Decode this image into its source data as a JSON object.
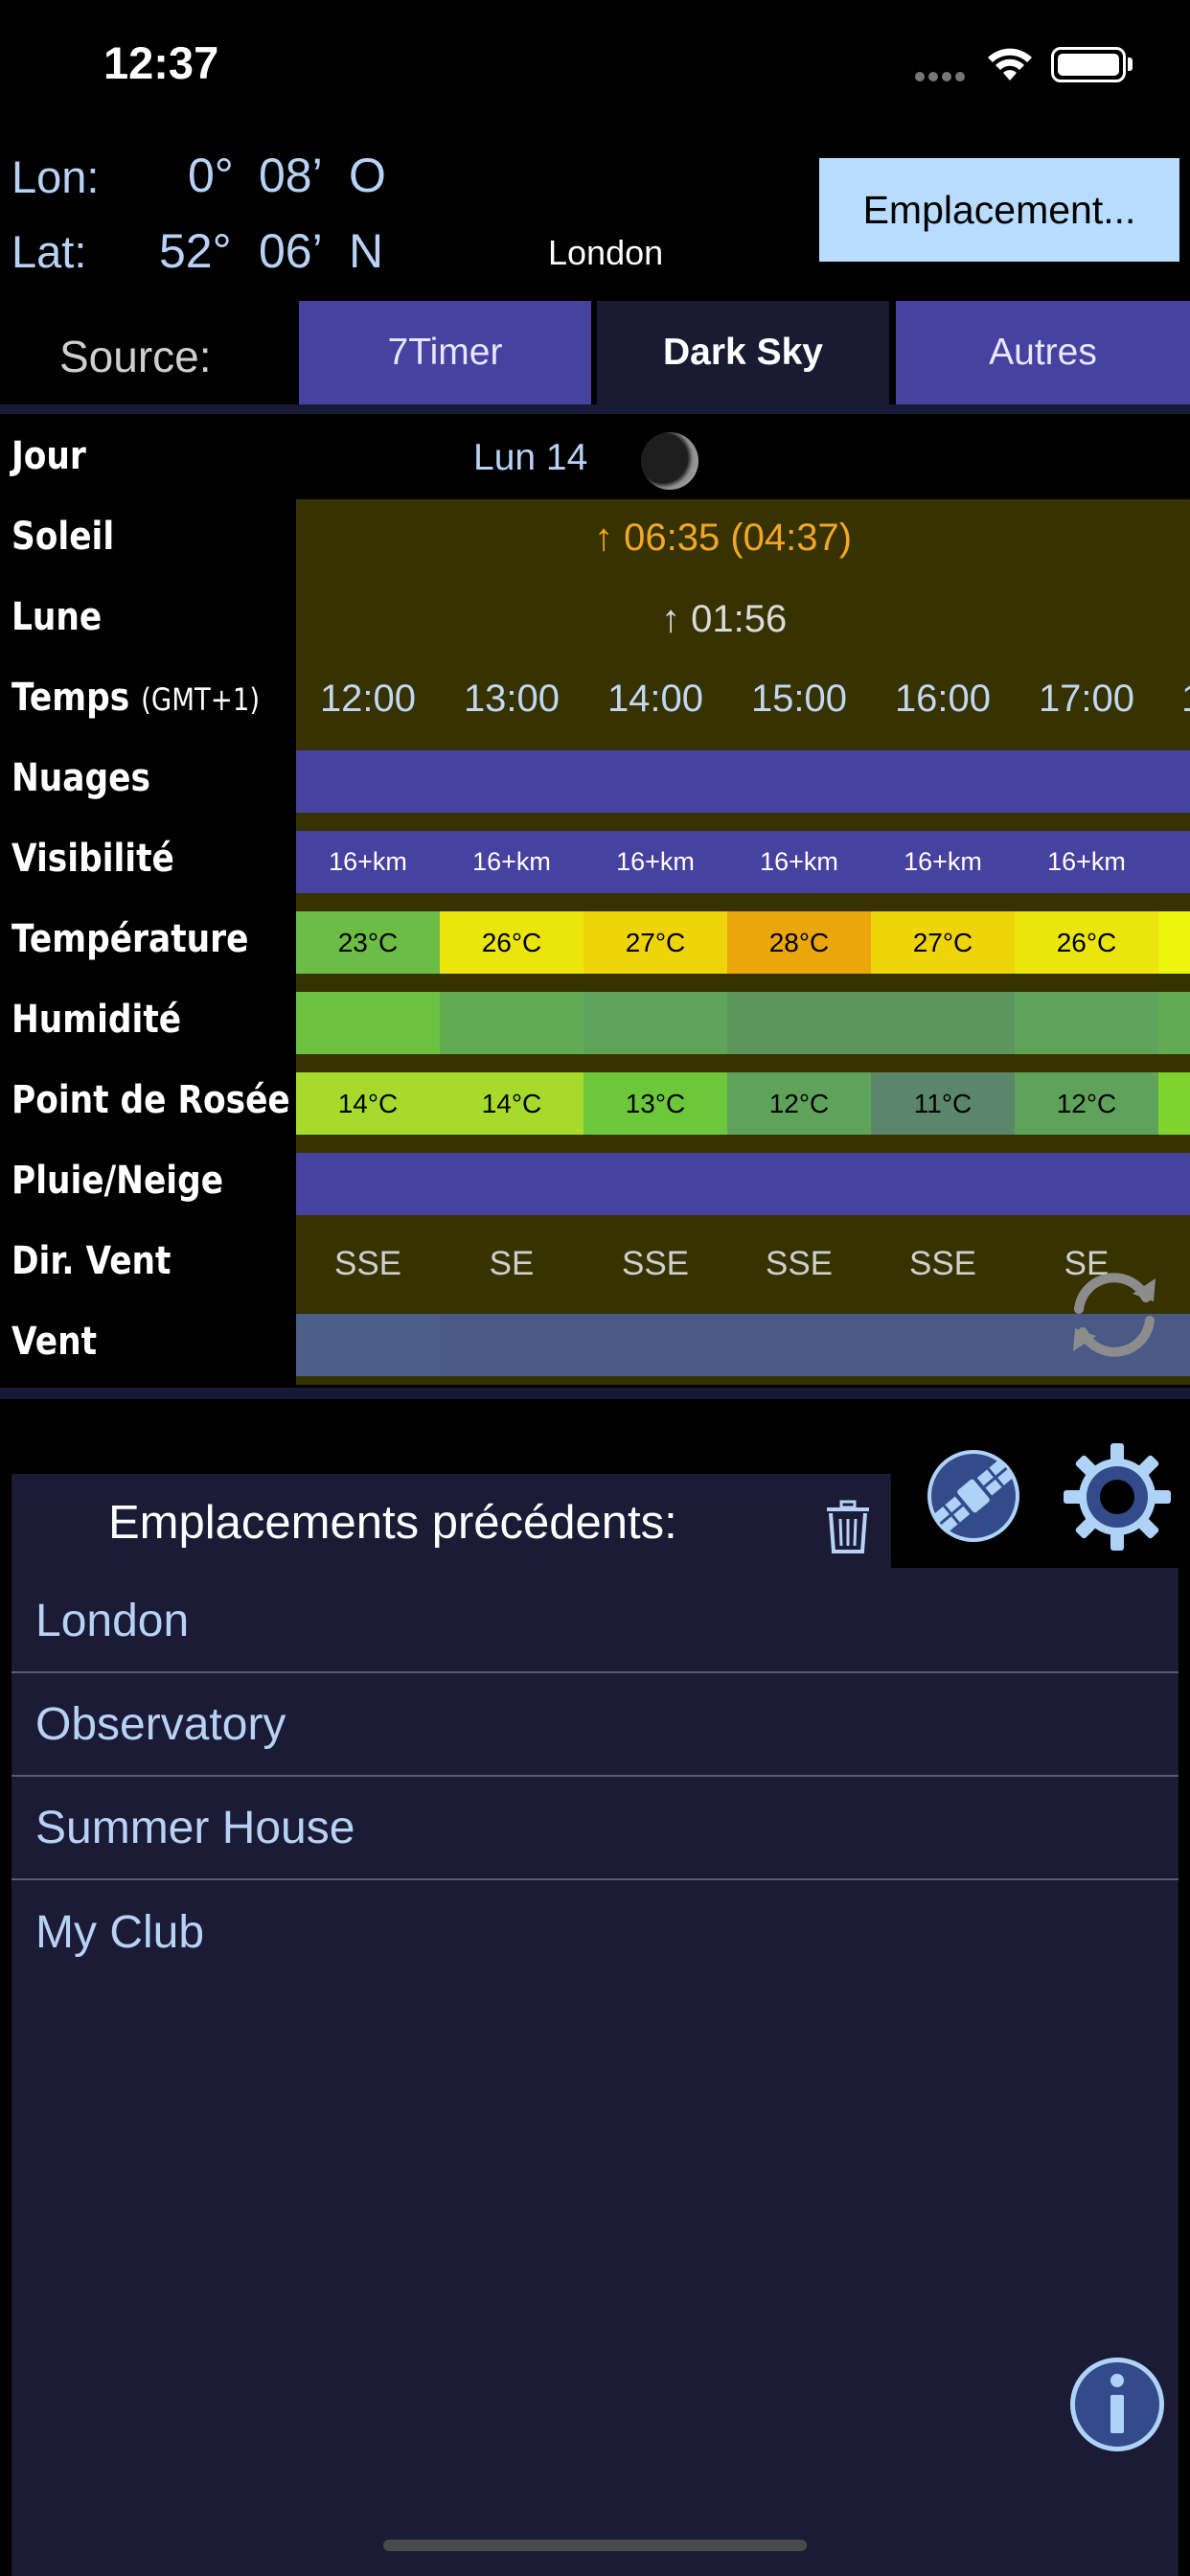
{
  "status_bar": {
    "time": "12:37"
  },
  "location": {
    "lon_label": "Lon:",
    "lon_deg": "0°",
    "lon_min": "08’",
    "lon_dir": "O",
    "lat_label": "Lat:",
    "lat_deg": "52°",
    "lat_min": "06’",
    "lat_dir": "N",
    "city": "London",
    "button_label": "Emplacement..."
  },
  "source": {
    "label": "Source:",
    "tabs": [
      {
        "label": "7Timer",
        "selected": false
      },
      {
        "label": "Dark Sky",
        "selected": true
      },
      {
        "label": "Autres",
        "selected": false
      }
    ]
  },
  "forecast": {
    "rows": {
      "day": "Jour",
      "sun": "Soleil",
      "moon": "Lune",
      "time": "Temps",
      "time_zone": "(GMT+1)",
      "clouds": "Nuages",
      "visibility": "Visibilité",
      "temperature": "Température",
      "humidity": "Humidité",
      "dew_point": "Point de Rosée",
      "precip": "Pluie/Neige",
      "wind_dir": "Dir. Vent",
      "wind": "Vent"
    },
    "day_value": "Lun 14",
    "sun_value": "↑ 06:35 (04:37)",
    "moon_value": "↑ 01:56",
    "hours": [
      "12:00",
      "13:00",
      "14:00",
      "15:00",
      "16:00",
      "17:00"
    ],
    "visibility": [
      "16+km",
      "16+km",
      "16+km",
      "16+km",
      "16+km",
      "16+km"
    ],
    "temperature": [
      "23°C",
      "26°C",
      "27°C",
      "28°C",
      "27°C",
      "26°C"
    ],
    "dew_point": [
      "14°C",
      "14°C",
      "13°C",
      "12°C",
      "11°C",
      "12°C"
    ],
    "wind_dir": [
      "SSE",
      "SE",
      "SSE",
      "SSE",
      "SSE",
      "SE"
    ],
    "colors": {
      "clouds": "#4642a0",
      "visibility": "#4642a0",
      "temperature": [
        "#6cbd45",
        "#eae50a",
        "#f0d40a",
        "#eaa60a",
        "#f0d40a",
        "#eae50a",
        "#eaf50a"
      ],
      "humidity": [
        "#6cc13f",
        "#62ab52",
        "#5fa35a",
        "#5b975d",
        "#5b975d",
        "#5fa35a",
        "#62ab52"
      ],
      "dew_point": [
        "#a6da2c",
        "#a6da2c",
        "#6cc83a",
        "#5fa35a",
        "#5a8669",
        "#5fa35a",
        "#7ed32e"
      ],
      "precip": "#4642a0",
      "wind": [
        "#4b5f8a",
        "#485a85",
        "#485a85",
        "#485a85",
        "#485a85",
        "#485a85",
        "#485a85"
      ]
    }
  },
  "history": {
    "title": "Emplacements précédents:",
    "items": [
      "London",
      "Observatory",
      "Summer House",
      "My Club"
    ]
  }
}
